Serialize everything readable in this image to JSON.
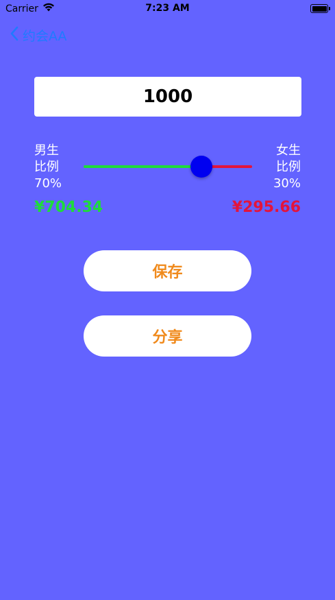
{
  "status_bar": {
    "carrier": "Carrier",
    "time": "7:23 AM"
  },
  "nav": {
    "back_title": "约会AA"
  },
  "amount": {
    "value": "1000"
  },
  "split": {
    "left_label_1": "男生",
    "left_label_2": "比例",
    "left_percent": "70%",
    "right_label_1": "女生",
    "right_label_2": "比例",
    "right_percent": "30%",
    "slider_value": 0.7,
    "left_amount": "¥704.34",
    "right_amount": "¥295.66"
  },
  "buttons": {
    "save": "保存",
    "share": "分享"
  },
  "colors": {
    "background": "#6363ff",
    "male": "#1edc3a",
    "female": "#e3143c",
    "thumb": "#0000f0",
    "button_text": "#f08a1c",
    "nav_link": "#1f7bff"
  },
  "icons": {
    "wifi": "wifi-icon",
    "battery": "battery-icon",
    "back": "chevron-left-icon"
  }
}
